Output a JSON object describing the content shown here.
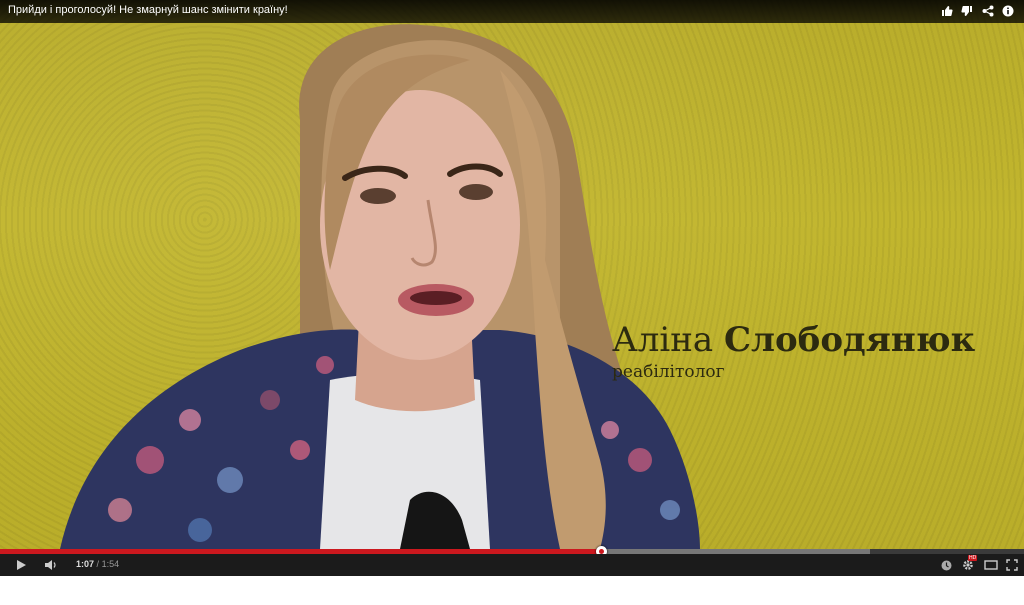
{
  "video": {
    "title": "Прийди і проголосуй! Не змарнуй шанс змінити країну!",
    "caption": {
      "first_name": "Аліна",
      "last_name": "Слободянюк",
      "role": "реабілітолог"
    }
  },
  "top_actions": {
    "icons": [
      "thumbs-up-icon",
      "thumbs-down-icon",
      "share-icon",
      "info-icon"
    ]
  },
  "player": {
    "current_time": "1:07",
    "separator": "/",
    "duration": "1:54",
    "played_fraction": 0.587,
    "buffered_fraction": 0.85,
    "hd_badge": "HD",
    "accent_color": "#cc181e"
  }
}
